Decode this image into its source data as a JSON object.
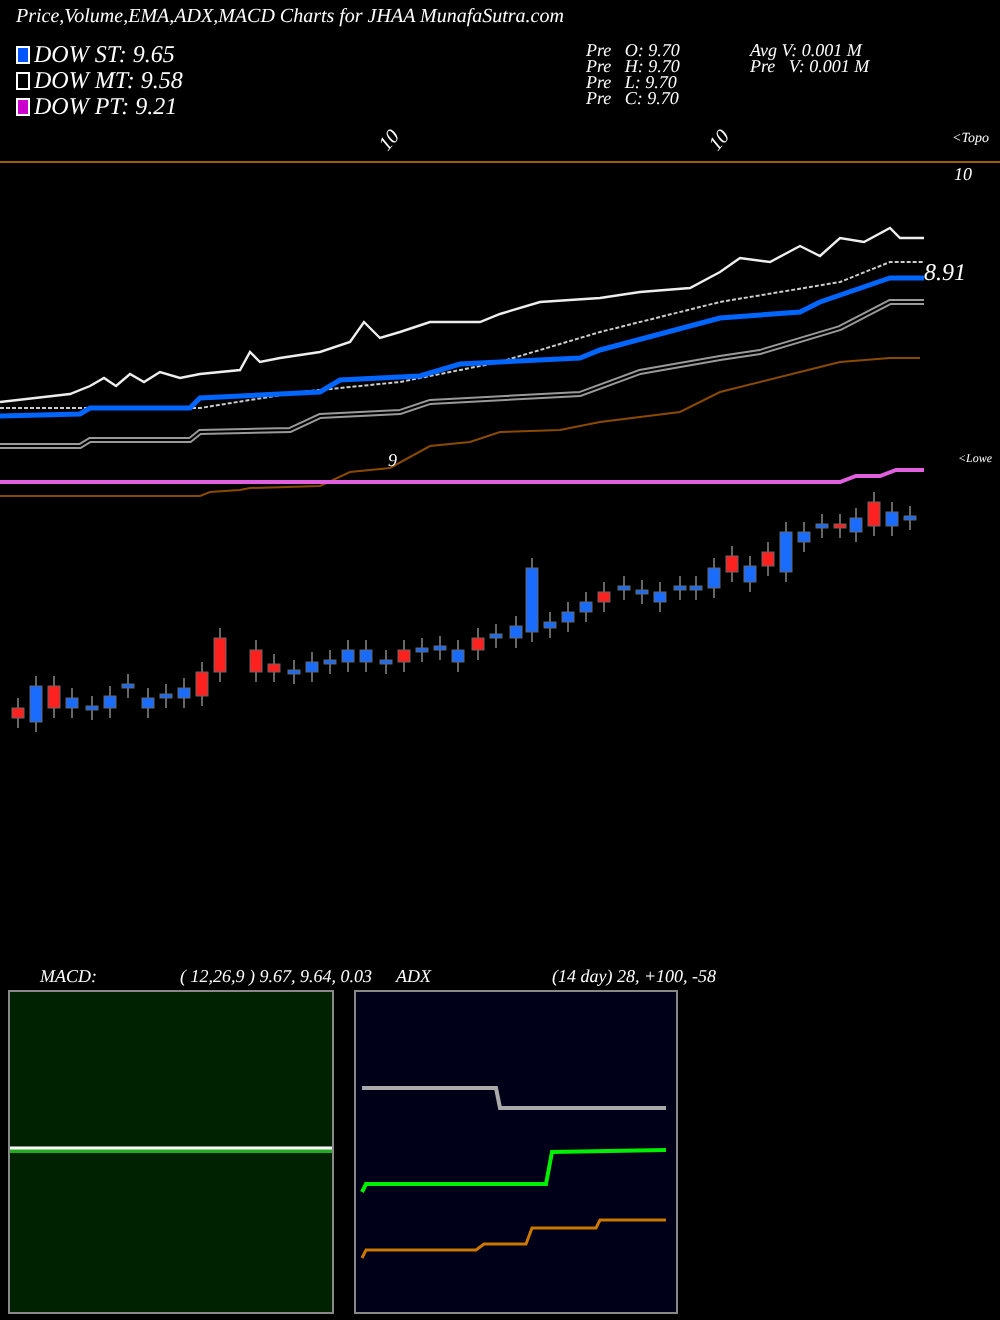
{
  "title": "Price,Volume,EMA,ADX,MACD Charts for JHAA MunafaSutra.com",
  "legend": [
    {
      "label": "DOW ST: 9.65",
      "color": "#0055ff"
    },
    {
      "label": "DOW MT: 9.58",
      "color": "#000000"
    },
    {
      "label": "DOW PT: 9.21",
      "color": "#cc00cc"
    }
  ],
  "prev": [
    "Pre   O: 9.70",
    "Pre   H: 9.70",
    "Pre   L: 9.70",
    "Pre   C: 9.70"
  ],
  "volume": [
    "Avg V: 0.001 M",
    "Pre   V: 0.001 M"
  ],
  "price_chart": {
    "rotated_labels": [
      "10",
      "10"
    ],
    "top_label": "<Topo",
    "top_value": "10",
    "last_value": "8.91",
    "mid_label": "9",
    "low_label": "<Lowe"
  },
  "macd": {
    "title": "MACD:",
    "values": "( 12,26,9 ) 9.67,  9.64,  0.03"
  },
  "adx": {
    "title": "ADX",
    "values": "(14  day) 28,  +100,  -58"
  }
}
